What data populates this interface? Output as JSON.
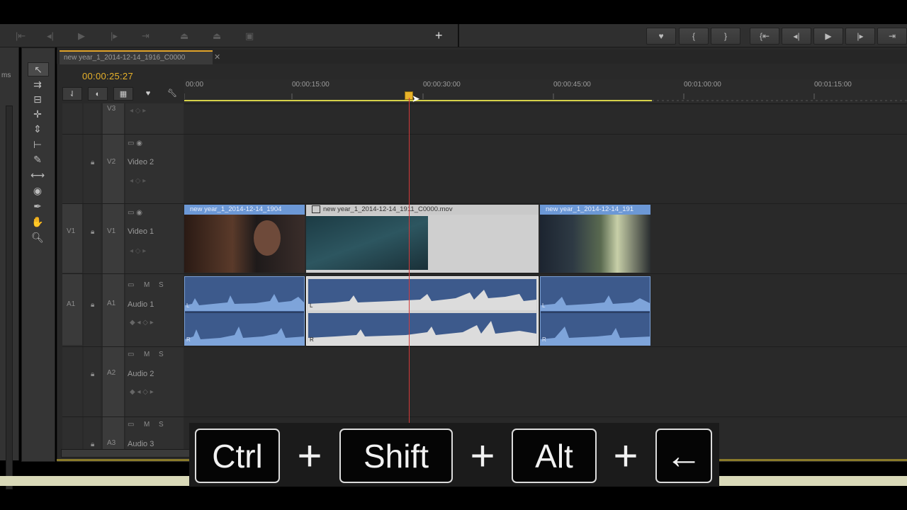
{
  "program_monitor": {
    "left_controls": [
      "step-back-icon",
      "prev-edit-icon",
      "play-icon",
      "next-edit-icon",
      "go-out-icon",
      "lift-icon",
      "extract-icon",
      "export-frame-icon",
      "add-icon"
    ],
    "right_controls": [
      "marker-icon",
      "mark-in-icon",
      "mark-out-icon",
      "go-to-in-icon",
      "step-back-icon",
      "play-icon",
      "step-forward-icon",
      "go-to-out-icon"
    ]
  },
  "left_panel": {
    "label": "ms"
  },
  "timeline": {
    "tab_label": "new year_1_2014-12-14_1916_C0000",
    "timecode": "00:00:25:27",
    "ruler_labels": [
      "00:00",
      "00:00:15:00",
      "00:00:30:00",
      "00:00:45:00",
      "00:01:00:00",
      "00:01:15:00"
    ],
    "tracks": {
      "v3": {
        "id": "V3"
      },
      "v2": {
        "id": "V2",
        "name": "Video 2"
      },
      "v1": {
        "source": "V1",
        "id": "V1",
        "name": "Video 1"
      },
      "a1": {
        "source": "A1",
        "id": "A1",
        "name": "Audio 1",
        "m": "M",
        "s": "S"
      },
      "a2": {
        "id": "A2",
        "name": "Audio 2",
        "m": "M",
        "s": "S"
      },
      "a3": {
        "id": "A3",
        "name": "Audio 3",
        "m": "M",
        "s": "S"
      }
    },
    "video_clips": [
      {
        "name": "new year_1_2014-12-14_1904"
      },
      {
        "name": "new year_1_2014-12-14_1911_C0000.mov"
      },
      {
        "name": "new year_1_2014-12-14_191"
      }
    ],
    "audio_channel_labels": [
      "L",
      "R"
    ]
  },
  "keys_overlay": {
    "keys": [
      "Ctrl",
      "Shift",
      "Alt",
      "←"
    ],
    "plus": "+"
  },
  "colors": {
    "accent": "#e8b22a",
    "clip_blue": "#6c98d6",
    "playhead": "#d43a3a"
  }
}
